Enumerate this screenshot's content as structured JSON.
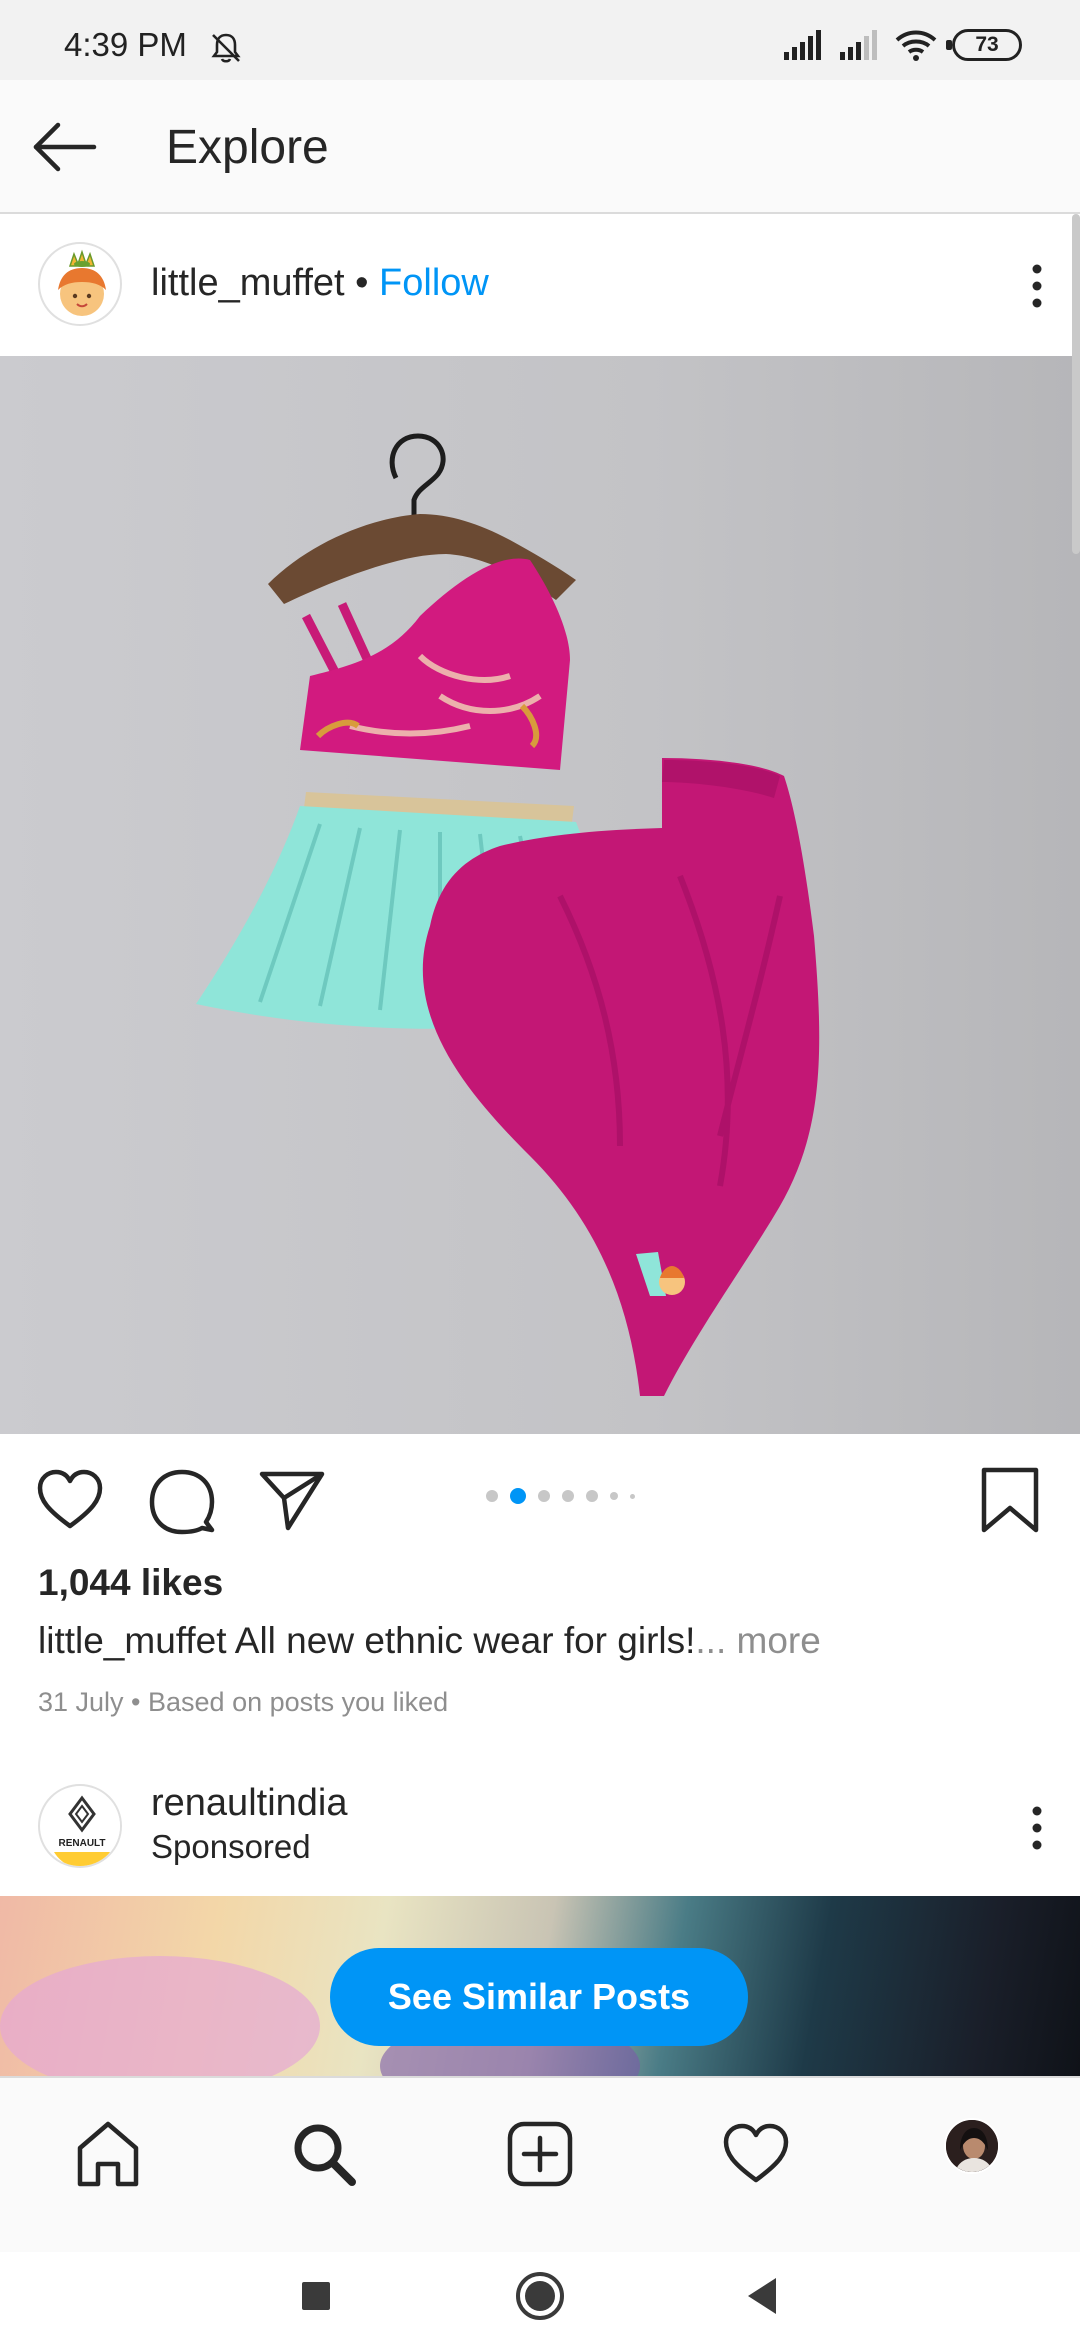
{
  "status_bar": {
    "time": "4:39 PM",
    "battery": "73",
    "icons": [
      "bell-off-icon",
      "cell-signal-icon",
      "cell-signal-icon",
      "wifi-icon",
      "battery-icon"
    ]
  },
  "header": {
    "title": "Explore",
    "back_icon": "arrow-left-icon"
  },
  "post": {
    "username": "little_muffet",
    "separator": " • ",
    "follow_label": "Follow",
    "likes": "1,044 likes",
    "caption_user": "little_muffet",
    "caption_text": " All new ethnic wear for girls!",
    "caption_more": "... more",
    "meta": "31 July • Based on posts you liked",
    "carousel_count": 6,
    "carousel_active_index": 1
  },
  "sponsored": {
    "username": "renaultindia",
    "label": "Sponsored",
    "avatar_text": "RENAULT"
  },
  "see_similar_label": "See Similar Posts",
  "bottom_nav": [
    "home-icon",
    "search-icon",
    "add-post-icon",
    "activity-heart-icon",
    "profile-avatar"
  ],
  "system_nav": [
    "recents-square-icon",
    "home-circle-icon",
    "back-triangle-icon"
  ],
  "colors": {
    "accent": "#0095f6",
    "text": "#262626",
    "secondary_text": "#8e8e8e"
  }
}
